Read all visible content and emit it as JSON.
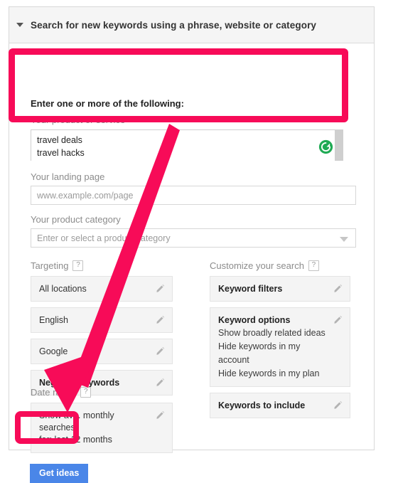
{
  "panel": {
    "header": {
      "collapse_icon": "triangle-down-icon",
      "title": "Search for new keywords using a phrase, website or category"
    }
  },
  "keywords_section": {
    "heading": "Enter one or more of the following:",
    "product_label": "Your product or service",
    "textarea_lines": [
      "travel deals",
      "travel hacks"
    ],
    "refresh_icon": "refresh-circle-icon",
    "highlight_color": "#f70b58"
  },
  "landing_page": {
    "label": "Your landing page",
    "placeholder": "www.example.com/page",
    "value": ""
  },
  "product_category": {
    "label": "Your product category",
    "placeholder": "Enter or select a product category",
    "value": "",
    "dropdown_icon": "chevron-down-icon"
  },
  "targeting": {
    "title": "Targeting",
    "help_icon": "?",
    "items": [
      {
        "label": "All locations",
        "bold": false,
        "edit_icon": "pencil-icon"
      },
      {
        "label": "English",
        "bold": false,
        "edit_icon": "pencil-icon"
      },
      {
        "label": "Google",
        "bold": false,
        "edit_icon": "pencil-icon"
      },
      {
        "label": "Negative keywords",
        "bold": true,
        "edit_icon": "pencil-icon"
      }
    ]
  },
  "customize": {
    "title": "Customize your search",
    "help_icon": "?",
    "cards": [
      {
        "title": "Keyword filters",
        "lines": [],
        "edit_icon": "pencil-icon"
      },
      {
        "title": "Keyword options",
        "lines": [
          "Show broadly related ideas",
          "Hide keywords in my account",
          "Hide keywords in my plan"
        ],
        "edit_icon": "pencil-icon"
      },
      {
        "title": "Keywords to include",
        "lines": [],
        "edit_icon": "pencil-icon"
      }
    ]
  },
  "date_range": {
    "title": "Date range",
    "help_icon": "?",
    "line1": "Show avg. monthly searches",
    "line2": "for: last 12 months",
    "edit_icon": "pencil-icon"
  },
  "actions": {
    "get_ideas_label": "Get ideas",
    "get_ideas_color": "#4a86e8"
  },
  "annotations": {
    "arrow_color": "#f70b58",
    "box_color": "#f70b58"
  }
}
